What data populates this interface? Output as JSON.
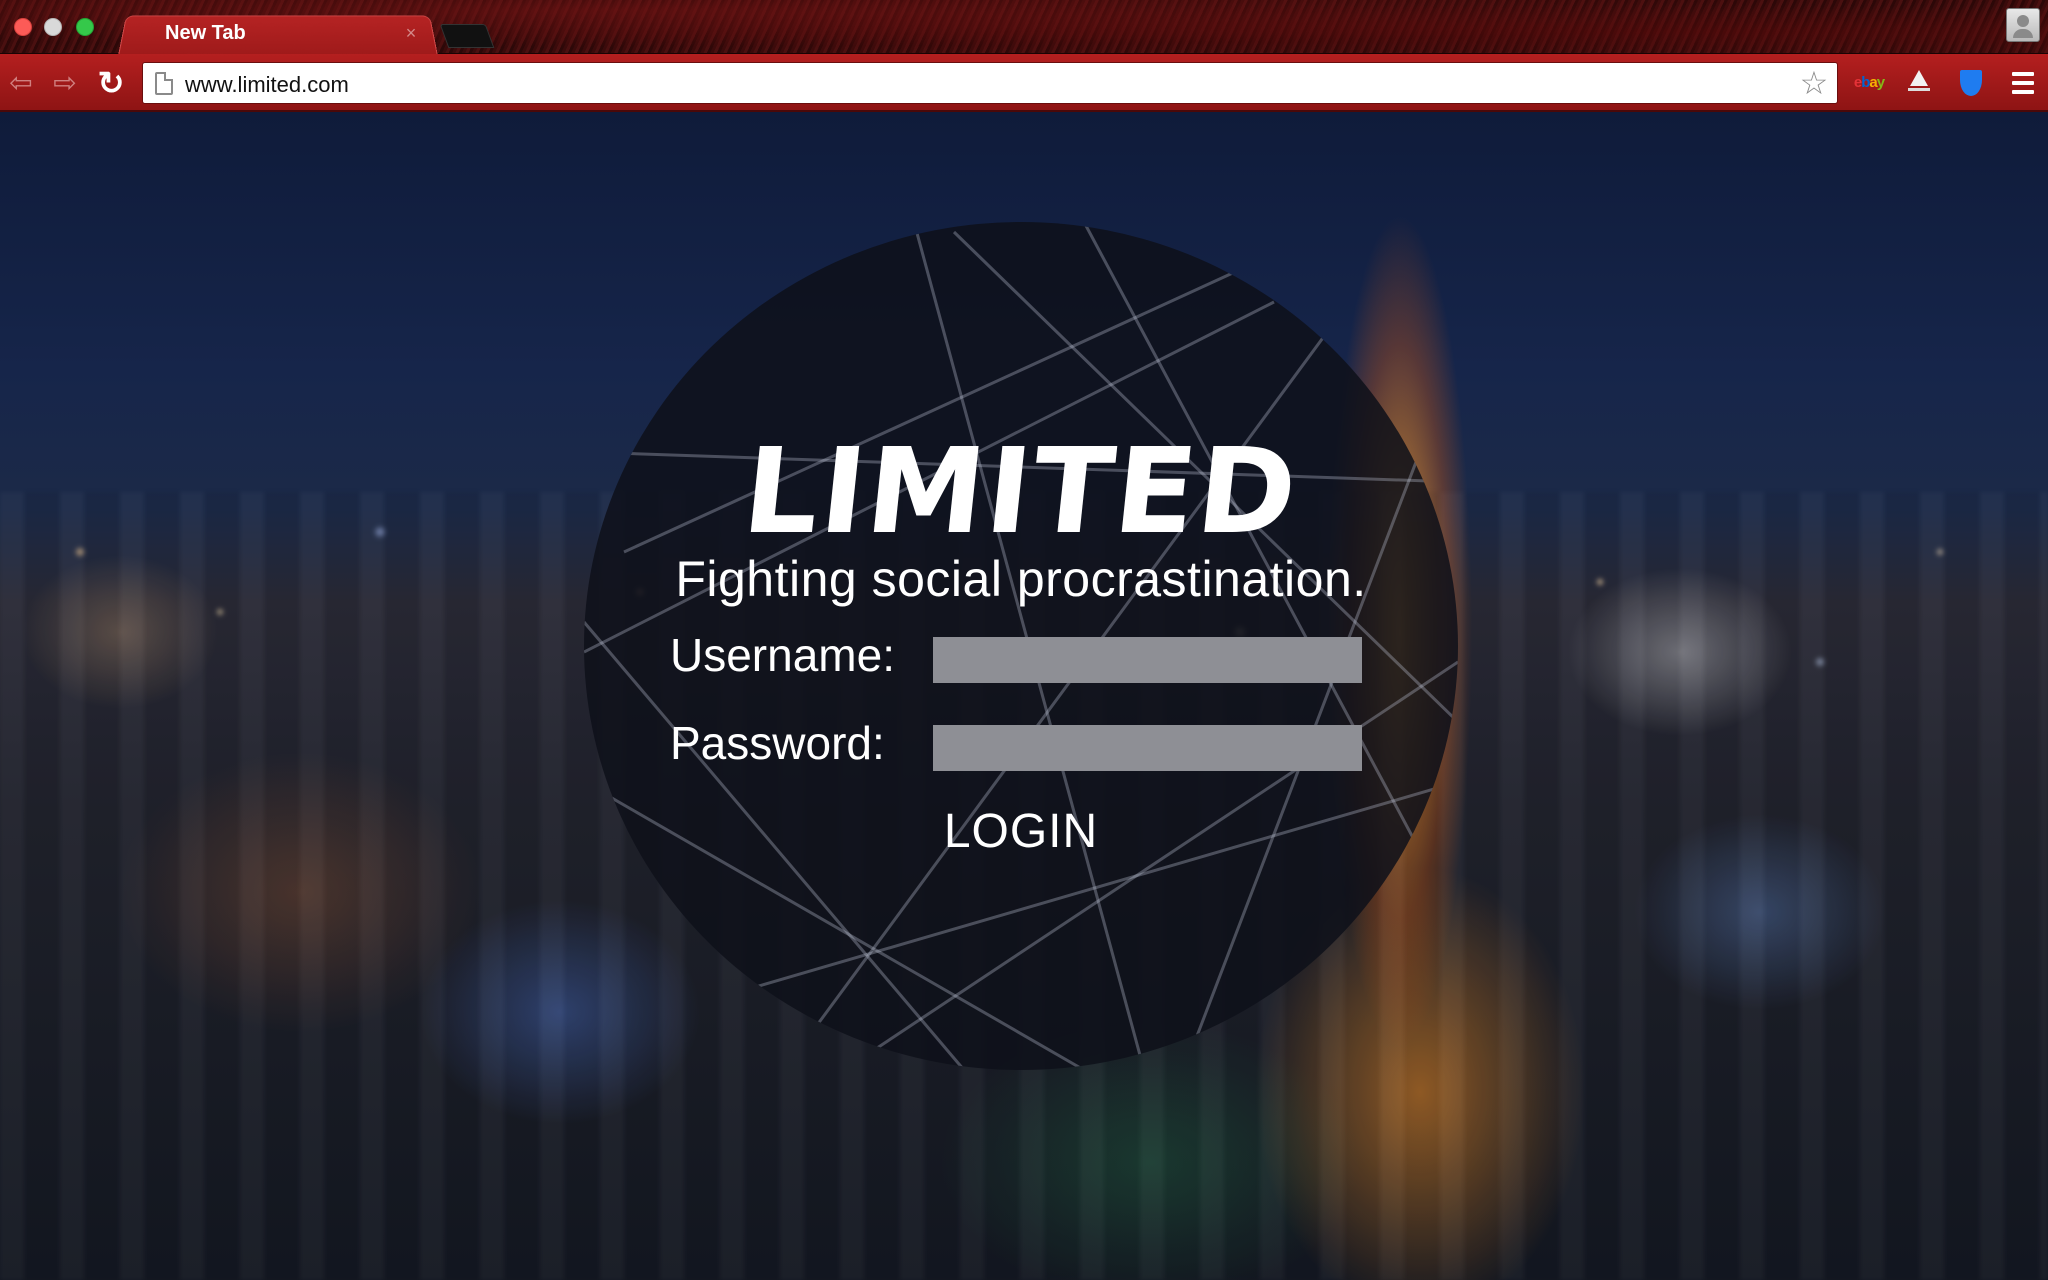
{
  "browser": {
    "tab_title": "New Tab",
    "tab_close_glyph": "×",
    "url": "www.limited.com",
    "extensions": {
      "ebay_letters": [
        "e",
        "b",
        "a",
        "y"
      ]
    }
  },
  "page": {
    "logo": "LIMITED",
    "tagline": "Fighting social procrastination.",
    "username_label": "Username:",
    "username_value": "",
    "password_label": "Password:",
    "password_value": "",
    "login_label": "LOGIN"
  },
  "colors": {
    "chrome_red": "#b41f1f",
    "circle_overlay": "#0e101a",
    "input_fill": "#8e8f95",
    "text": "#ffffff"
  }
}
